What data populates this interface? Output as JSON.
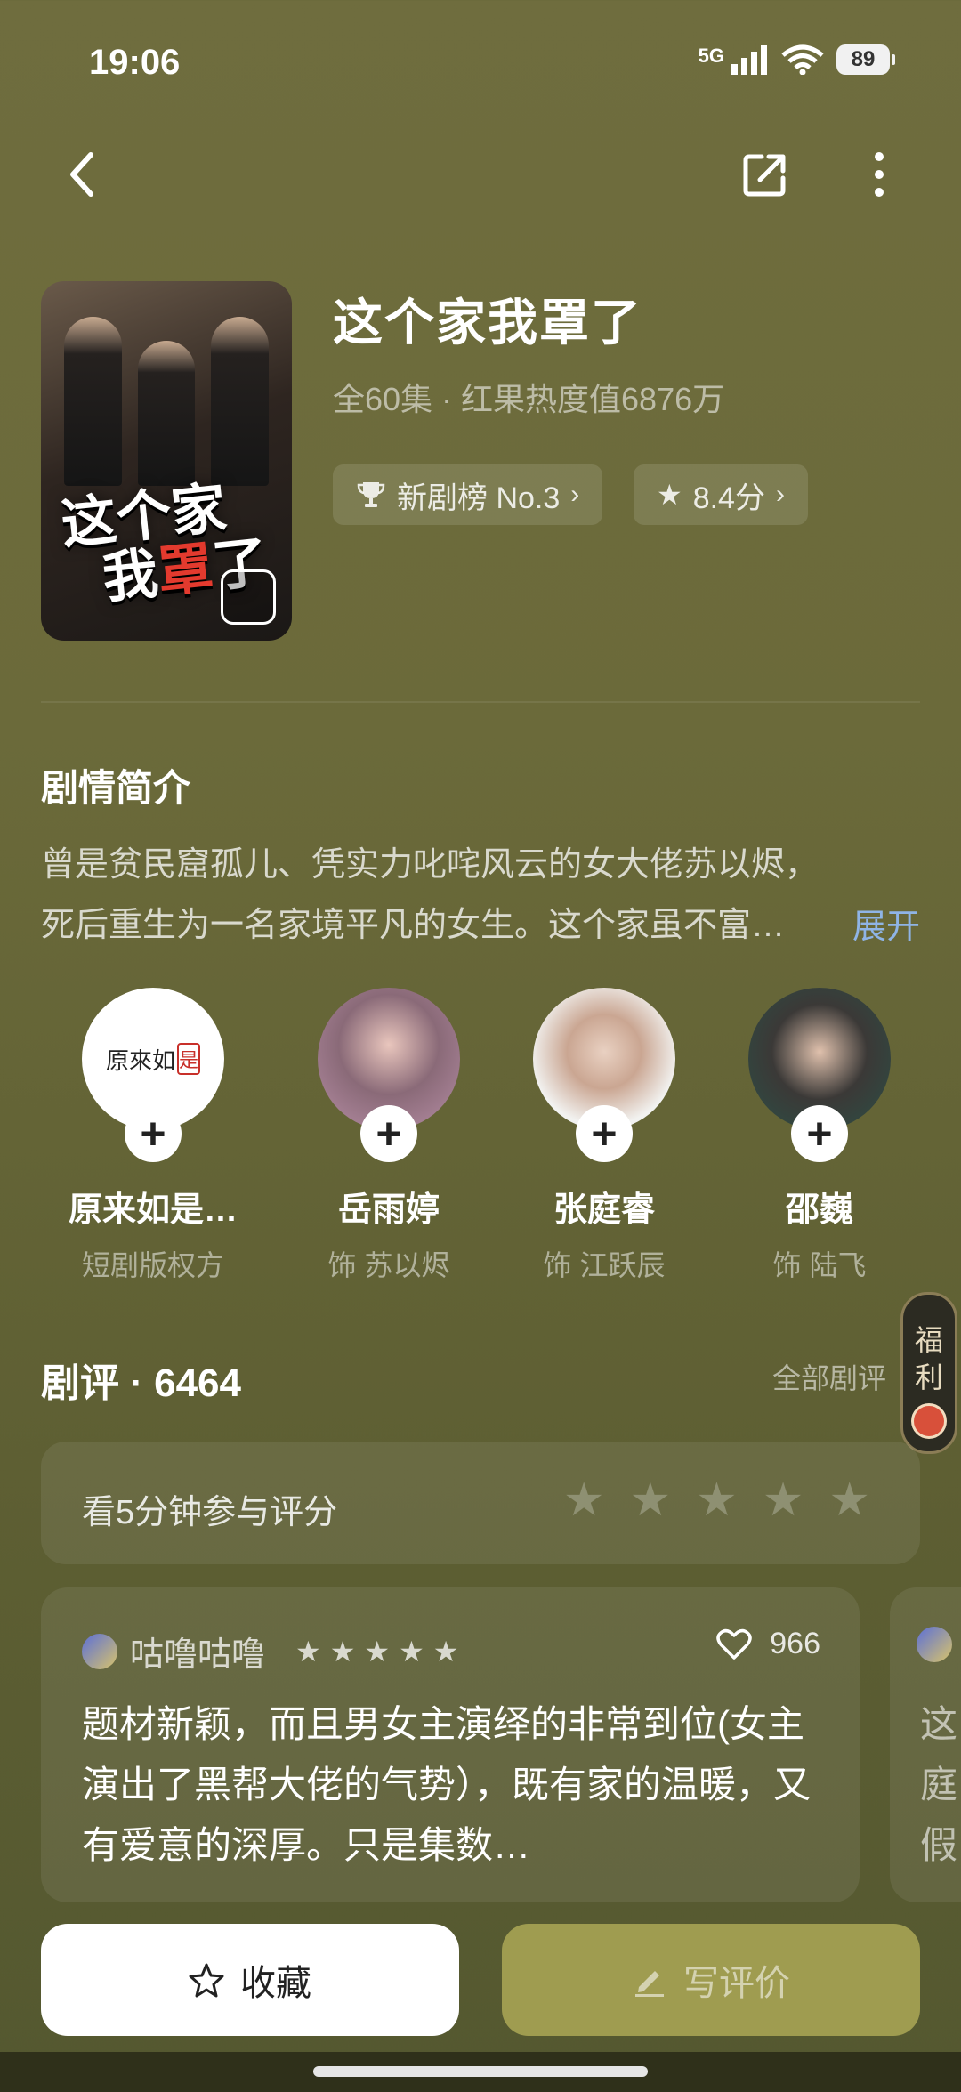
{
  "status": {
    "time": "19:06",
    "network": "5G",
    "battery": "89"
  },
  "show": {
    "title": "这个家我罩了",
    "meta": "全60集 · 红果热度值6876万",
    "rank_chip": "新剧榜 No.3",
    "score_chip": "8.4分",
    "poster_title_line1": "这个家",
    "poster_title_line2a": "我",
    "poster_title_line2b": "罩",
    "poster_title_line2c": "了"
  },
  "synopsis": {
    "heading": "剧情简介",
    "text": "曾是贫民窟孤儿、凭实力叱咤风云的女大佬苏以烬，死后重生为一名家境平凡的女生。这个家虽不富…",
    "expand": "展开"
  },
  "cast": [
    {
      "name": "原来如是…",
      "role": "短剧版权方",
      "logo_text": "原來如",
      "logo_mark": "是"
    },
    {
      "name": "岳雨婷",
      "role": "饰 苏以烬"
    },
    {
      "name": "张庭睿",
      "role": "饰 江跃辰"
    },
    {
      "name": "邵巍",
      "role": "饰 陆飞"
    }
  ],
  "reviews": {
    "heading": "剧评 · 6464",
    "all_label": "全部剧评",
    "rate_prompt": "看5分钟参与评分",
    "card": {
      "user": "咕噜咕噜",
      "likes": "966",
      "text": "题材新颖，而且男女主演绎的非常到位(女主演出了黑帮大佬的气势），既有家的温暖，又有爱意的深厚。只是集数…",
      "rating": 5
    },
    "peek_text": [
      "这",
      "庭",
      "假"
    ]
  },
  "side_tab": {
    "line1": "福",
    "line2": "利"
  },
  "actions": {
    "collect": "收藏",
    "write_review": "写评价"
  },
  "colors": {
    "accent_link": "#8fb4e6",
    "write_button": "#9f9c50",
    "background": "#6b6a3a"
  }
}
